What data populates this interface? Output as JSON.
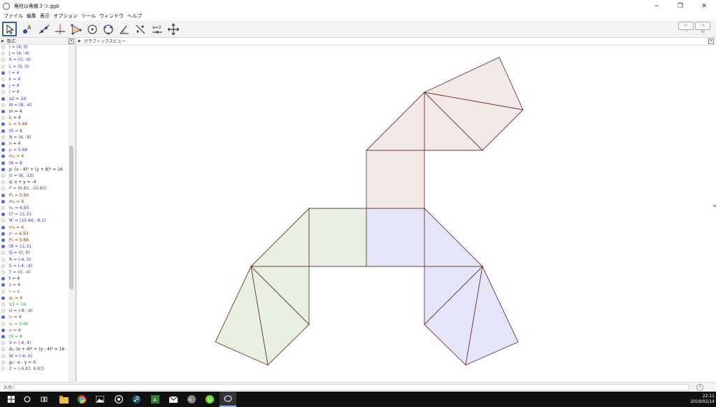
{
  "window": {
    "title": "角柱は角錐３つ.ggb"
  },
  "window_controls": {
    "minimize": "−",
    "maximize": "❐",
    "close": "✕"
  },
  "menu": [
    "ファイル",
    "編集",
    "表示",
    "オプション",
    "ツール",
    "ウィンドウ",
    "ヘルプ"
  ],
  "toolbar": {
    "tools": [
      {
        "name": "move-tool",
        "glyph": "↖"
      },
      {
        "name": "point-tool",
        "glyph": "•A"
      },
      {
        "name": "line-tool",
        "glyph": "╱"
      },
      {
        "name": "perpendicular-line-tool",
        "glyph": "⊥"
      },
      {
        "name": "polygon-tool",
        "glyph": "▷"
      },
      {
        "name": "circle-tool",
        "glyph": "⊙"
      },
      {
        "name": "ellipse-tool",
        "glyph": "◌"
      },
      {
        "name": "angle-tool",
        "glyph": "∠"
      },
      {
        "name": "reflect-tool",
        "glyph": "⤡"
      },
      {
        "name": "slider-tool",
        "glyph": "a=2"
      },
      {
        "name": "move-graphics-tool",
        "glyph": "✥"
      }
    ],
    "undo": "↶",
    "redo": "↷"
  },
  "algebra": {
    "header": "数式",
    "rows": [
      {
        "text": "I = (4, 0)",
        "dot": "off",
        "color": "#3333cc"
      },
      {
        "text": "J = (4, -4)",
        "dot": "off",
        "color": "#3333cc"
      },
      {
        "text": "K = (0, -4)",
        "dot": "off",
        "color": "#3333cc"
      },
      {
        "text": "L = (0, 0)",
        "dot": "off",
        "color": "#3333cc"
      },
      {
        "text": "i = 4",
        "dot": "on",
        "color": "#3333cc"
      },
      {
        "text": "k = 4",
        "dot": "off",
        "color": "#3333cc"
      },
      {
        "text": "j = 4",
        "dot": "on",
        "color": "#3333cc"
      },
      {
        "text": "i = 4",
        "dot": "off",
        "color": "#3333cc"
      },
      {
        "text": "q2 = 16",
        "dot": "on",
        "color": "#3333cc"
      },
      {
        "text": "M = (8, -4)",
        "dot": "off",
        "color": "#3333cc"
      },
      {
        "text": "m = 4",
        "dot": "on",
        "color": "#222222"
      },
      {
        "text": "l₁ = 4",
        "dot": "off",
        "color": "#222222"
      },
      {
        "text": "i₁ = 5.66",
        "dot": "on",
        "color": "#993300"
      },
      {
        "text": "t5 = 8",
        "dot": "on",
        "color": "#3333cc"
      },
      {
        "text": "N = (4, -8)",
        "dot": "off",
        "color": "#3333cc"
      },
      {
        "text": "n = 4",
        "dot": "on",
        "color": "#222222"
      },
      {
        "text": "j₂ = 5.66",
        "dot": "on",
        "color": "#3333cc"
      },
      {
        "text": "m₁ = 4",
        "dot": "on",
        "color": "#993300"
      },
      {
        "text": "t6 = 8",
        "dot": "on",
        "color": "#3333cc"
      },
      {
        "text": "p: (x - 4)² + (y + 8)² = 16",
        "dot": "on",
        "color": "#222222"
      },
      {
        "text": "O = (8, -10)",
        "dot": "off",
        "color": "#3333cc"
      },
      {
        "text": "q: x + y = -4",
        "dot": "off",
        "color": "#222222"
      },
      {
        "text": "P = (6.83, -10.83)",
        "dot": "off",
        "color": "#555555"
      },
      {
        "text": "P₁ = 5.66",
        "dot": "on",
        "color": "#993300"
      },
      {
        "text": "m₂ = 4",
        "dot": "on",
        "color": "#993300"
      },
      {
        "text": "n₁ = 6.93",
        "dot": "off",
        "color": "#3333cc"
      },
      {
        "text": "t7 = 11.31",
        "dot": "on",
        "color": "#3333cc"
      },
      {
        "text": "N' = (10.44, -9.1)",
        "dot": "off",
        "color": "#3333cc"
      },
      {
        "text": "m₃ = 4",
        "dot": "on",
        "color": "#993300"
      },
      {
        "text": "n' = 6.93",
        "dot": "on",
        "color": "#993300"
      },
      {
        "text": "P₂ = 5.66",
        "dot": "on",
        "color": "#993300"
      },
      {
        "text": "t8 = 11.31",
        "dot": "on",
        "color": "#3333cc"
      },
      {
        "text": "Q = (0, 0)",
        "dot": "off",
        "color": "#3333cc"
      },
      {
        "text": "R = (-4, 0)",
        "dot": "off",
        "color": "#3333cc"
      },
      {
        "text": "S = (-4, -4)",
        "dot": "off",
        "color": "#3333cc"
      },
      {
        "text": "T = (0, -4)",
        "dot": "off",
        "color": "#555555"
      },
      {
        "text": "t = 4",
        "dot": "on",
        "color": "#222222"
      },
      {
        "text": "s = 4",
        "dot": "on",
        "color": "#993300"
      },
      {
        "text": "r = 4",
        "dot": "off",
        "color": "#33aa33"
      },
      {
        "text": "q₁ = 4",
        "dot": "on",
        "color": "#993300"
      },
      {
        "text": "q3 = 16",
        "dot": "off",
        "color": "#33aa33"
      },
      {
        "text": "U = (-8, -4)",
        "dot": "off",
        "color": "#3333cc"
      },
      {
        "text": "r₁ = 4",
        "dot": "on",
        "color": "#993300"
      },
      {
        "text": "s₁ = 5.66",
        "dot": "off",
        "color": "#33aa33"
      },
      {
        "text": "u = 4",
        "dot": "on",
        "color": "#993300"
      },
      {
        "text": "t9 = 8",
        "dot": "on",
        "color": "#33aa33"
      },
      {
        "text": "V = (-4, 4)",
        "dot": "off",
        "color": "#3333cc"
      },
      {
        "text": "d₁: (x + 4)² + (y - 4)² = 16",
        "dot": "off",
        "color": "#222222"
      },
      {
        "text": "W = (-6, 6)",
        "dot": "off",
        "color": "#3333cc"
      },
      {
        "text": "g₁: -x - y = 0",
        "dot": "off",
        "color": "#222222"
      },
      {
        "text": "Z = (-6.83, 6.83)",
        "dot": "off",
        "color": "#555555"
      }
    ]
  },
  "graphics": {
    "header": "グラフィックスビュー",
    "colors": {
      "pink_fill": "#f3e9e6",
      "green_fill": "#e8f1e1",
      "blue_fill": "#e4e5f8",
      "stroke": "#6b3a3a"
    }
  },
  "input_bar": {
    "label": "入力:",
    "value": ""
  },
  "taskbar": {
    "icons": [
      "windows-start-icon",
      "search-circle-icon",
      "task-view-icon",
      "file-explorer-icon",
      "chrome-icon",
      "photos-icon",
      "media-icon",
      "steam-icon",
      "app-icon",
      "mail-icon",
      "game-icon",
      "upwork-icon",
      "geogebra-icon"
    ],
    "time": "22:11",
    "date": "2019/02/14"
  }
}
